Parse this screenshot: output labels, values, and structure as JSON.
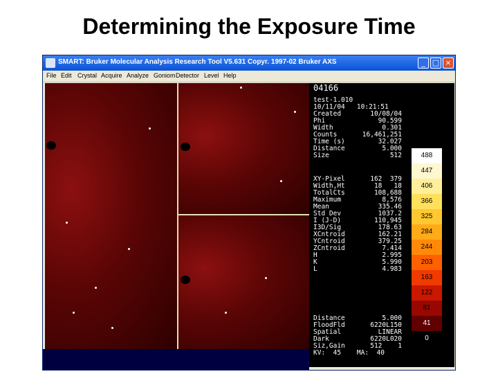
{
  "slide": {
    "title": "Determining the Exposure Time"
  },
  "window": {
    "title": "SMART: Bruker Molecular Analysis Research Tool V5.631 Copyr. 1997-02 Bruker AXS",
    "minimize_label": "_",
    "maximize_label": "□",
    "close_label": "×"
  },
  "menu": [
    "File",
    "Edit",
    "Crystal",
    "Acquire",
    "Analyze",
    "Goniom",
    "Detector",
    "Level",
    "Help"
  ],
  "panel": {
    "frame_id": "04166",
    "file_line": "test-1.010",
    "date_line": "10/11/04   10:21:51",
    "header_rows": [
      {
        "k": "Created",
        "v": "10/08/04"
      },
      {
        "k": "Phi",
        "v": "90.599"
      },
      {
        "k": "Width",
        "v": "0.301"
      },
      {
        "k": "Counts",
        "v": "16,461,251"
      },
      {
        "k": "Time (s)",
        "v": "32.027"
      },
      {
        "k": "Distance",
        "v": "5.000"
      },
      {
        "k": "Size",
        "v": "512"
      }
    ],
    "stats_rows": [
      {
        "k": "XY-Pixel",
        "v": "162  379"
      },
      {
        "k": "Width,Ht",
        "v": "18   18"
      },
      {
        "k": "TotalCts",
        "v": "108,688"
      },
      {
        "k": "Maximum",
        "v": "8,576"
      },
      {
        "k": "Mean",
        "v": "335.46"
      },
      {
        "k": "Std Dev",
        "v": "1037.2"
      },
      {
        "k": "I (J-D)",
        "v": "110,945"
      },
      {
        "k": "I3D/Sig",
        "v": "178.63"
      },
      {
        "k": "XCntroid",
        "v": "162.21"
      },
      {
        "k": "YCntroid",
        "v": "379.25"
      },
      {
        "k": "ZCntroid",
        "v": "7.414"
      },
      {
        "k": "H",
        "v": "2.995"
      },
      {
        "k": "K",
        "v": "5.990"
      },
      {
        "k": "L",
        "v": "4.983"
      }
    ],
    "footer_rows": [
      {
        "k": "Distance",
        "v": "5.000"
      },
      {
        "k": "FloodFld",
        "v": "6220L150"
      },
      {
        "k": "Spatial",
        "v": "LINEAR"
      },
      {
        "k": "Dark",
        "v": "6220L020"
      },
      {
        "k": "Siz,Gain",
        "v": "512    1"
      }
    ],
    "kv_line": "KV:  45    MA:  40"
  },
  "colorbar": {
    "labels": [
      "488",
      "447",
      "406",
      "366",
      "325",
      "284",
      "244",
      "203",
      "163",
      "122",
      "81",
      "41",
      "0"
    ],
    "colors": [
      "#ffffff",
      "#fff7d0",
      "#ffef9a",
      "#ffe05a",
      "#ffc830",
      "#ffaa18",
      "#ff8a08",
      "#ff6000",
      "#f03a00",
      "#c81800",
      "#980800",
      "#600000",
      "#000000"
    ],
    "text_colors": [
      "#000000",
      "#000000",
      "#000000",
      "#000000",
      "#000000",
      "#000000",
      "#000000",
      "#000000",
      "#000000",
      "#000000",
      "#000000",
      "#ffffff",
      "#ffffff"
    ]
  }
}
